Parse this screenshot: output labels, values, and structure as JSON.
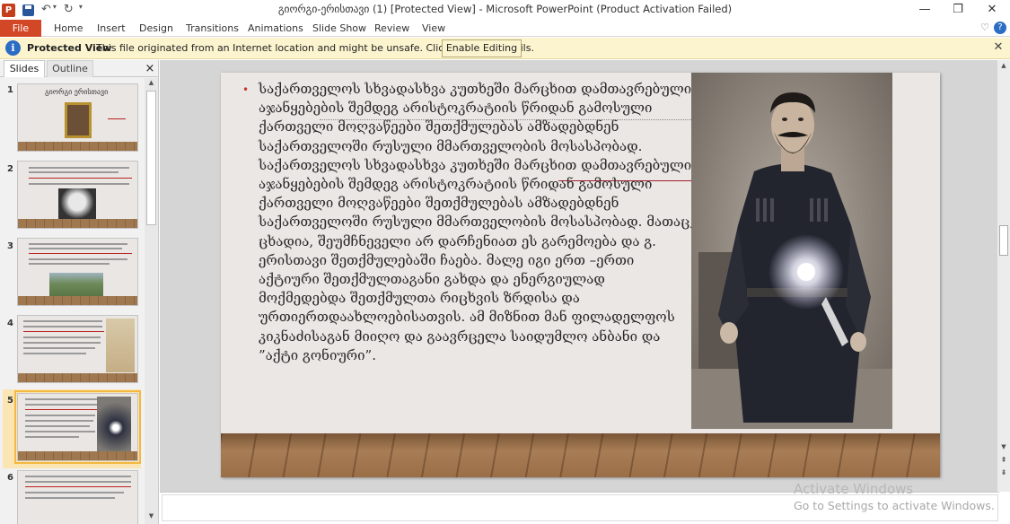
{
  "window": {
    "title": "გიორგი-ერისთავი (1) [Protected View]  -  Microsoft PowerPoint (Product Activation Failed)",
    "app_icon": "P",
    "minimize": "—",
    "restore": "❐",
    "close": "✕"
  },
  "ribbon": {
    "tabs": [
      "File",
      "Home",
      "Insert",
      "Design",
      "Transitions",
      "Animations",
      "Slide Show",
      "Review",
      "View"
    ]
  },
  "message_bar": {
    "icon": "i",
    "title": "Protected View",
    "text": "This file originated from an Internet location and might be unsafe. Click for more details.",
    "button": "Enable Editing",
    "close": "✕"
  },
  "left_pane": {
    "tabs": [
      "Slides",
      "Outline"
    ],
    "close": "×",
    "slide_numbers": [
      "1",
      "2",
      "3",
      "4",
      "5",
      "6"
    ],
    "slide1_title": "გიორგი ერისთავი",
    "selected": 5
  },
  "slide": {
    "bullet": "•",
    "text": "საქართველოს სხვადასხვა კუთხეში მარცხით დამთავრებული აჯანყებების შემდეგ არისტოკრატიის წრიდან გამოსული ქართველი მოღვაწეები შეთქმულებას ამზადებდნენ საქართველოში რუსული მმართველობის მოსასპობად. საქართველოს სხვადასხვა კუთხეში მარცხით დამთავრებული აჯანყებების შემდეგ არისტოკრატიის წრიდან გამოსული ქართველი მოღვაწეები შეთქმულებას ამზადებდნენ საქართველოში რუსული მმართველობის მოსასპობად. მათაც, ცხადია, შეუმჩნეველი არ დარჩენიათ ეს გარემოება და გ. ერისთავი შეთქმულებაში ჩაება. მალე იგი ერთ –ერთი აქტიური შეთქმულთაგანი გახდა და ენერგიულად მოქმედებდა შეთქმულთა რიცხვის ზრდისა და ურთიერთდაახლოებისათვის. ამ მიზნით მან ფილადელფოს კიკნაძისაგან მიიღო და გაავრცელა საიდუმლო ანბანი და ”აქტი გონიური”."
  },
  "watermark": {
    "title": "Activate Windows",
    "subtitle": "Go to Settings to activate Windows."
  },
  "colors": {
    "file_tab": "#d24726",
    "message_bar": "#fcf4cf",
    "info_icon": "#2b6cc4",
    "bullet": "#c0392b",
    "selected_thumb": "#f4b840"
  }
}
